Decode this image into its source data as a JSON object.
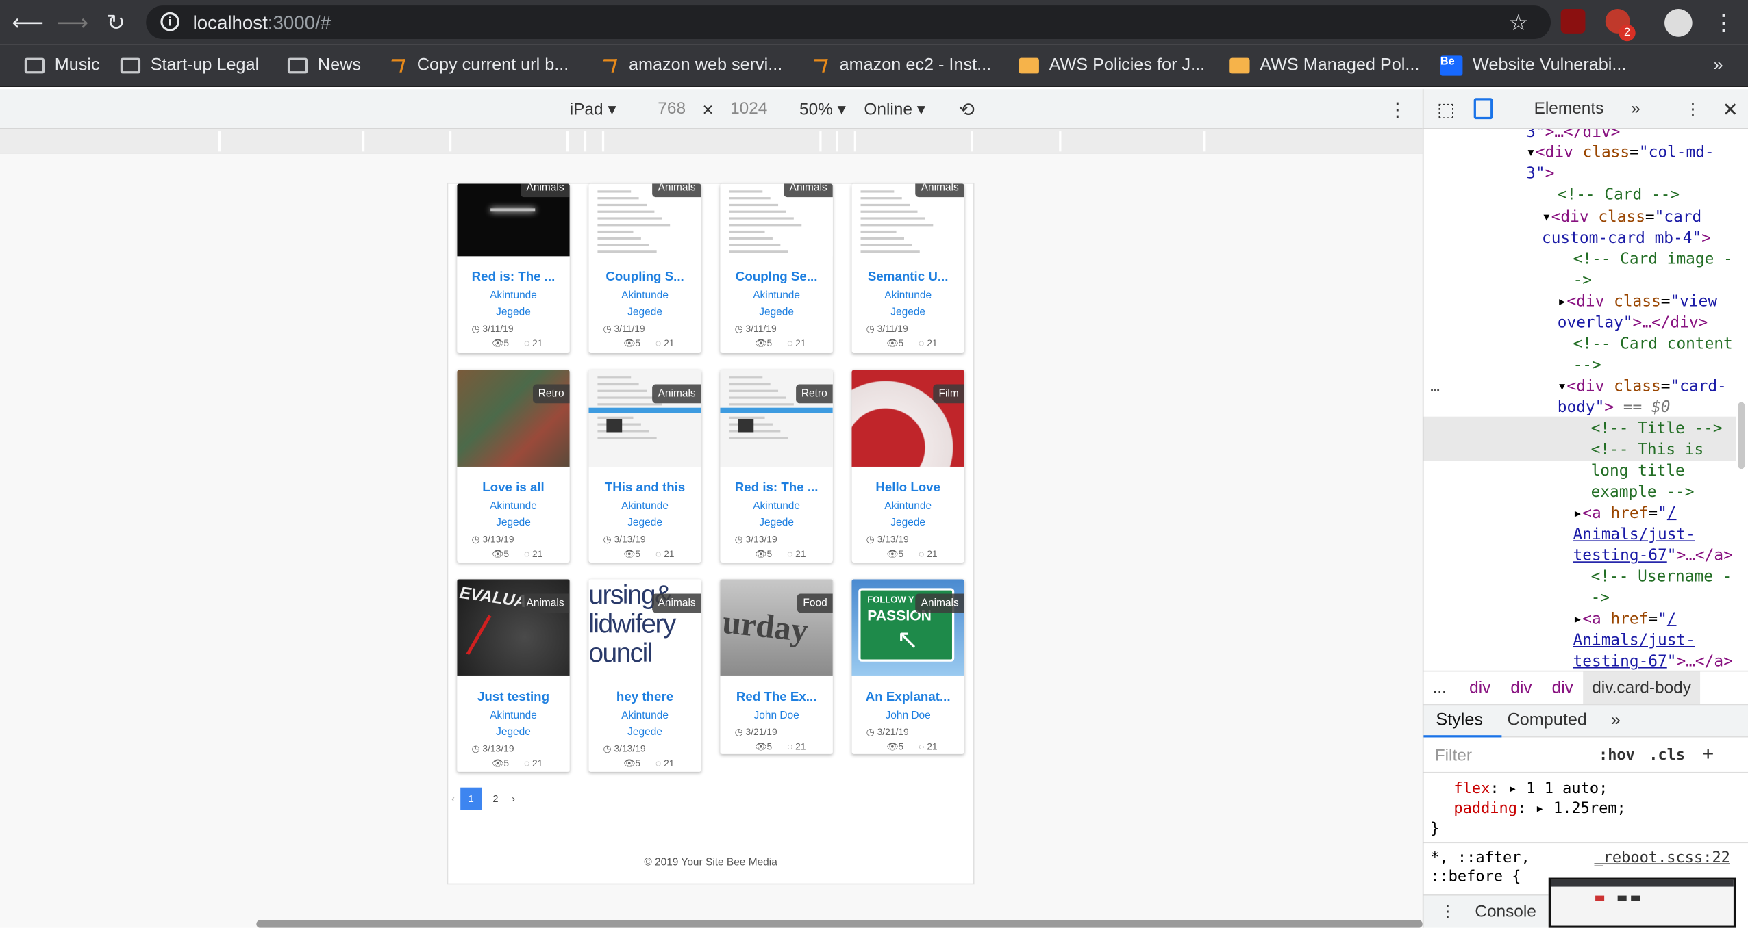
{
  "browser": {
    "url_host": "localhost",
    "url_port": ":3000/#",
    "ext_badge": "2"
  },
  "bookmarks": [
    {
      "label": "Music",
      "icon": "folder-icon"
    },
    {
      "label": "Start-up Legal",
      "icon": "folder-icon"
    },
    {
      "label": "News",
      "icon": "folder-icon"
    },
    {
      "label": "Copy current url b...",
      "icon": "stackoverflow-icon"
    },
    {
      "label": "amazon web servi...",
      "icon": "stackoverflow-icon"
    },
    {
      "label": "amazon ec2 - Inst...",
      "icon": "stackoverflow-icon"
    },
    {
      "label": "AWS Policies for J...",
      "icon": "aws-icon"
    },
    {
      "label": "AWS Managed Pol...",
      "icon": "aws-icon"
    },
    {
      "label": "Website Vulnerabi...",
      "icon": "behance-icon"
    }
  ],
  "device_toolbar": {
    "device": "iPad",
    "width": "768",
    "times": "×",
    "height": "1024",
    "zoom": "50%",
    "network": "Online"
  },
  "cards": [
    {
      "title": "Red is: The ...",
      "author": "Akintunde Jegede",
      "date": "3/11/19",
      "views": "5",
      "comments": "21",
      "badge": "Animals"
    },
    {
      "title": "Coupling S...",
      "author": "Akintunde Jegede",
      "date": "3/11/19",
      "views": "5",
      "comments": "21",
      "badge": "Animals"
    },
    {
      "title": "Couplng Se...",
      "author": "Akintunde Jegede",
      "date": "3/11/19",
      "views": "5",
      "comments": "21",
      "badge": "Animals"
    },
    {
      "title": "Semantic U...",
      "author": "Akintunde Jegede",
      "date": "3/11/19",
      "views": "5",
      "comments": "21",
      "badge": "Animals"
    },
    {
      "title": "Love is all",
      "author": "Akintunde Jegede",
      "date": "3/13/19",
      "views": "5",
      "comments": "21",
      "badge": "Retro"
    },
    {
      "title": "THis and this",
      "author": "Akintunde Jegede",
      "date": "3/13/19",
      "views": "5",
      "comments": "21",
      "badge": "Animals"
    },
    {
      "title": "Red is: The ...",
      "author": "Akintunde Jegede",
      "date": "3/13/19",
      "views": "5",
      "comments": "21",
      "badge": "Retro"
    },
    {
      "title": "Hello Love",
      "author": "Akintunde Jegede",
      "date": "3/13/19",
      "views": "5",
      "comments": "21",
      "badge": "Film"
    },
    {
      "title": "Just testing",
      "author": "Akintunde Jegede",
      "date": "3/13/19",
      "views": "5",
      "comments": "21",
      "badge": "Animals"
    },
    {
      "title": "hey there",
      "author": "Akintunde Jegede",
      "date": "3/13/19",
      "views": "5",
      "comments": "21",
      "badge": "Animals"
    },
    {
      "title": "Red The Ex...",
      "author": "John Doe",
      "date": "3/21/19",
      "views": "5",
      "comments": "21",
      "badge": "Food"
    },
    {
      "title": "An Explanat...",
      "author": "John Doe",
      "date": "3/21/19",
      "views": "5",
      "comments": "21",
      "badge": "Animals"
    }
  ],
  "image_text": {
    "evaluate": "EVALUA",
    "nursing1": "ursing&",
    "nursing2": "lidwifery",
    "nursing3": "ouncil",
    "saturday": "urday",
    "follow": "FOLLOW Y",
    "passion": "PASSION"
  },
  "pagination": {
    "prev": "‹",
    "pages": [
      "1",
      "2"
    ],
    "next": "›"
  },
  "footer": "© 2019 Your Site Bee Media",
  "devtools": {
    "tabs": {
      "elements": "Elements",
      "more": "»"
    },
    "breadcrumbs": [
      "...",
      "div",
      "div",
      "div",
      "div.card-body"
    ],
    "style_tabs": [
      "Styles",
      "Computed",
      "»"
    ],
    "filter_placeholder": "Filter",
    "hov": ":hov",
    "cls": ".cls",
    "plus": "+",
    "css_flex_prop": "flex",
    "css_flex_val": "1 1 auto;",
    "css_padding_prop": "padding",
    "css_padding_val": "1.25rem;",
    "css_close": "}",
    "css_selector": "*, ::after,",
    "css_selector2": "::before {",
    "css_source": "_reboot.scss:22",
    "console": "Console"
  }
}
